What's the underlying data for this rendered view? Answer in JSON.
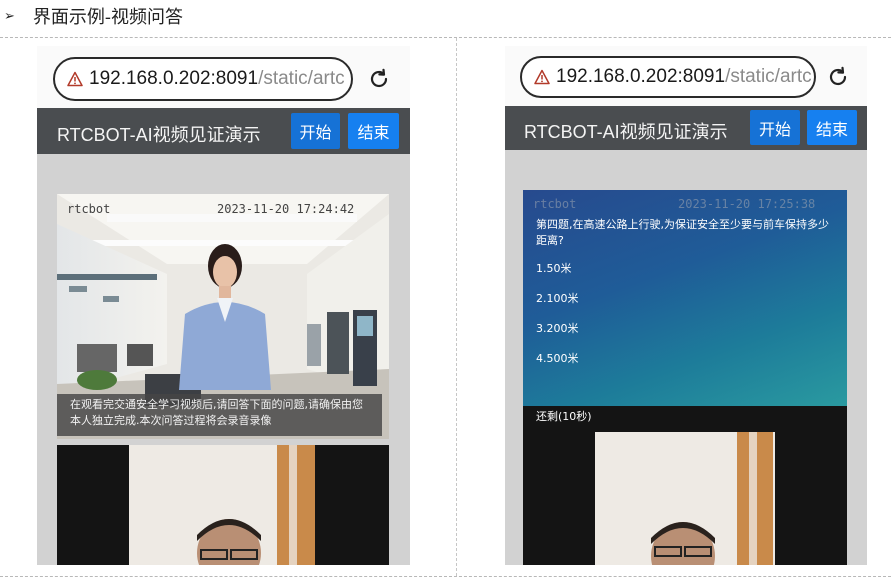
{
  "doc": {
    "bullet": "➢",
    "heading": "界面示例-视频问答"
  },
  "browser": {
    "url_host": "192.168.0.202:8091",
    "url_path": "/static/artc"
  },
  "app": {
    "title": "RTCBOT-AI视频见证演示",
    "start_label": "开始",
    "end_label": "结束"
  },
  "left_screen": {
    "stream_label": "rtcbot",
    "timestamp": "2023-11-20  17:24:42",
    "caption_line1": "在观看完交通安全学习视频后,请回答下面的问题,请确保由您",
    "caption_line2": "本人独立完成.本次问答过程将会录音录像"
  },
  "right_screen": {
    "stream_label": "rtcbot",
    "timestamp": "2023-11-20  17:25:38",
    "question_line1": "第四题,在高速公路上行驶,为保证安全至少要与前车保持多少",
    "question_line2": "距离?",
    "options": [
      "1.50米",
      "2.100米",
      "3.200米",
      "4.500米"
    ],
    "countdown": "还剩(10秒)"
  },
  "icons": {
    "warning": "warning-triangle-icon",
    "reload": "reload-icon"
  },
  "colors": {
    "appbar": "#4a4d50",
    "button": "#1680f0",
    "quiz_background": "#1f5c98"
  }
}
